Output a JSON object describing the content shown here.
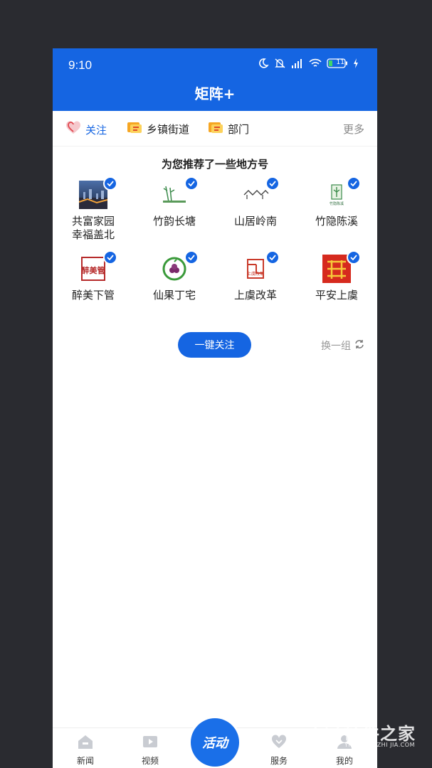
{
  "status_bar": {
    "time": "9:10",
    "battery": "11"
  },
  "header": {
    "title": "矩阵+"
  },
  "tabs": [
    {
      "label": "关注",
      "icon": "heart-icon",
      "active": true
    },
    {
      "label": "乡镇街道",
      "icon": "tag-icon"
    },
    {
      "label": "部门",
      "icon": "tag-icon"
    }
  ],
  "tabs_more": "更多",
  "recommend_title": "为您推荐了一些地方号",
  "accounts": [
    {
      "name": "共富家园幸福盖北",
      "logo": "city-photo"
    },
    {
      "name": "竹韵长塘",
      "logo": "bamboo-logo"
    },
    {
      "name": "山居岭南",
      "logo": "house-logo"
    },
    {
      "name": "竹隐陈溪",
      "logo": "green-logo",
      "logo_text": "竹隐陈溪"
    },
    {
      "name": "醉美下管",
      "logo": "seal-logo",
      "logo_text": "醉美管"
    },
    {
      "name": "仙果丁宅",
      "logo": "fruit-logo"
    },
    {
      "name": "上虞改革",
      "logo": "red-seal-logo",
      "logo_text": "上虞改革"
    },
    {
      "name": "平安上虞",
      "logo": "red-square-logo"
    }
  ],
  "follow_all_button": "一键关注",
  "refresh_label": "换一组",
  "bottom_nav": [
    {
      "label": "新闻",
      "icon": "home-icon"
    },
    {
      "label": "视频",
      "icon": "video-icon"
    },
    {
      "label": "活动",
      "icon": "activity-icon"
    },
    {
      "label": "服务",
      "icon": "heart-icon"
    },
    {
      "label": "我的",
      "icon": "user-icon"
    }
  ],
  "watermark": {
    "text": "硬件之家",
    "sub": "YING JIAN ZHI JIA.COM"
  },
  "colors": {
    "primary": "#1565e2",
    "background": "#2a2b30"
  }
}
